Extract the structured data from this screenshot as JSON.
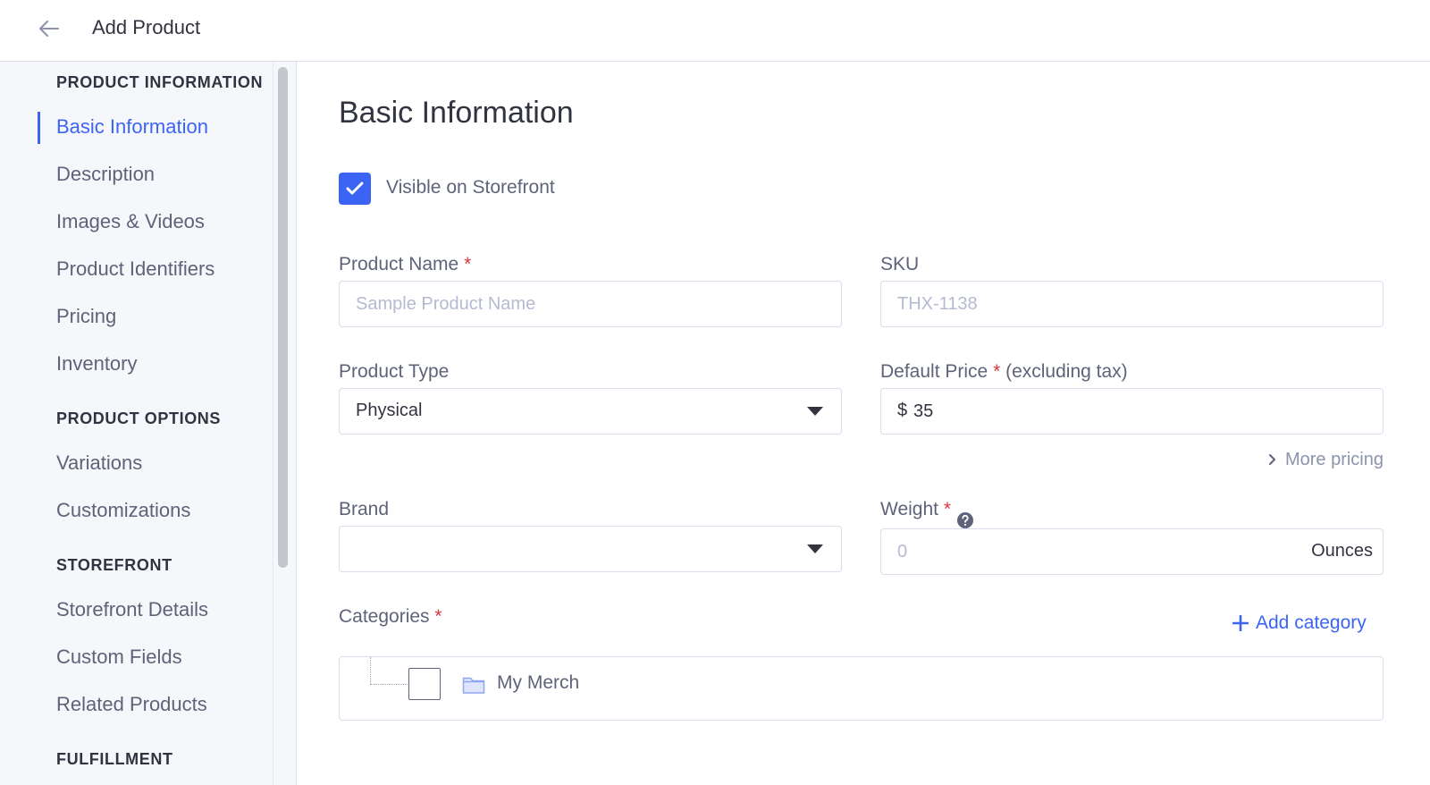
{
  "header": {
    "title": "Add Product",
    "back_icon": "arrow-left-icon"
  },
  "sidebar": {
    "sections": [
      {
        "heading": "PRODUCT INFORMATION",
        "items": [
          {
            "label": "Basic Information",
            "active": true
          },
          {
            "label": "Description"
          },
          {
            "label": "Images & Videos"
          },
          {
            "label": "Product Identifiers"
          },
          {
            "label": "Pricing"
          },
          {
            "label": "Inventory"
          }
        ]
      },
      {
        "heading": "PRODUCT OPTIONS",
        "items": [
          {
            "label": "Variations"
          },
          {
            "label": "Customizations"
          }
        ]
      },
      {
        "heading": "STOREFRONT",
        "items": [
          {
            "label": "Storefront Details"
          },
          {
            "label": "Custom Fields"
          },
          {
            "label": "Related Products"
          }
        ]
      },
      {
        "heading": "FULFILLMENT",
        "items": []
      }
    ]
  },
  "main": {
    "title": "Basic Information",
    "visible_checkbox": {
      "label": "Visible on Storefront",
      "checked": true
    },
    "product_name": {
      "label": "Product Name",
      "required_mark": "*",
      "placeholder": "Sample Product Name",
      "value": ""
    },
    "sku": {
      "label": "SKU",
      "placeholder": "THX-1138",
      "value": ""
    },
    "product_type": {
      "label": "Product Type",
      "value": "Physical"
    },
    "default_price": {
      "label": "Default Price",
      "required_mark": "*",
      "suffix": "(excluding tax)",
      "currency": "$",
      "value": "35"
    },
    "more_pricing": {
      "label": "More pricing"
    },
    "brand": {
      "label": "Brand",
      "value": ""
    },
    "weight": {
      "label": "Weight",
      "required_mark": "*",
      "placeholder": "0",
      "unit": "Ounces"
    },
    "categories": {
      "label": "Categories",
      "required_mark": "*",
      "add_label": "Add category",
      "items": [
        {
          "name": "My Merch",
          "checked": false
        }
      ]
    }
  },
  "colors": {
    "accent": "#3c64f4",
    "required": "#db3643",
    "sidebar_bg": "#f5f7fa",
    "border": "#d9dce9"
  }
}
